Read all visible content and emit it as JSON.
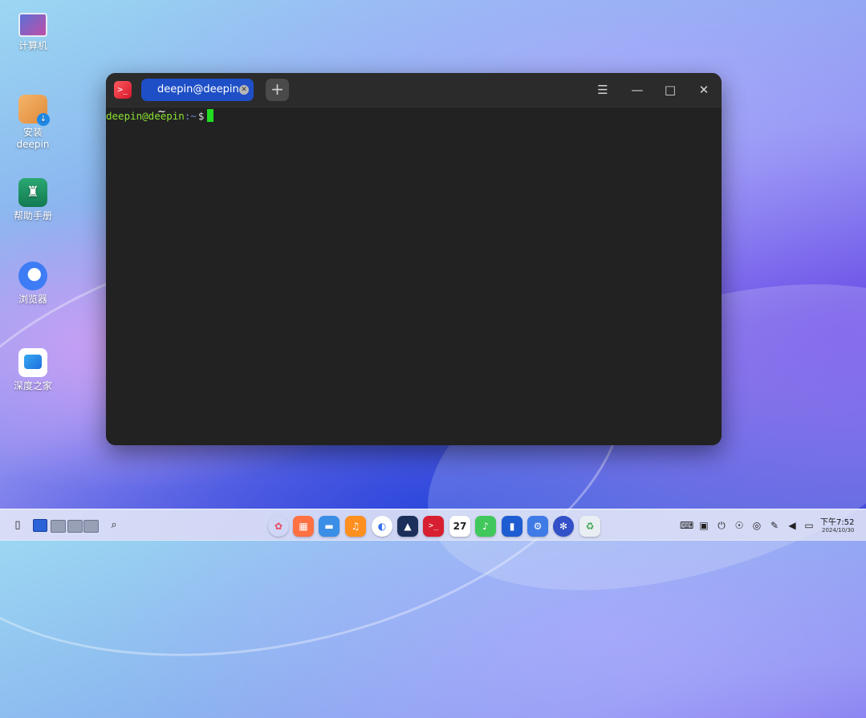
{
  "desktop": {
    "icons": [
      {
        "label": "计算机",
        "icon": "computer-icon"
      },
      {
        "label": "安装\ndeepin",
        "line1": "安装",
        "line2": "deepin",
        "icon": "install-deepin-icon"
      },
      {
        "label": "帮助手册",
        "icon": "help-manual-icon"
      },
      {
        "label": "浏览器",
        "icon": "browser-icon"
      },
      {
        "label": "深度之家",
        "icon": "deepin-home-icon"
      }
    ]
  },
  "terminal": {
    "tab_title": "deepin@deepin: ~",
    "new_tab_symbol": "+",
    "window_controls": {
      "menu": "☰",
      "minimize": "—",
      "maximize": "□",
      "close": "✕"
    },
    "prompt_user": "deepin@deepin",
    "prompt_path": ":~",
    "prompt_symbol": "$",
    "colors": {
      "background": "#222222",
      "tab_active": "#1f4fc7",
      "prompt_user": "#8ae234",
      "cursor": "#22dd22"
    }
  },
  "dock": {
    "left": {
      "trash_icon": "clipboard-icon",
      "search_icon": "🔍"
    },
    "apps": [
      {
        "name": "launcher",
        "glyph": "✿",
        "color": "#ffffff"
      },
      {
        "name": "app-store",
        "glyph": "▦",
        "color": "#ff7043"
      },
      {
        "name": "file-manager",
        "glyph": "▬",
        "color": "#3a8ee6"
      },
      {
        "name": "music-box",
        "glyph": "♫",
        "color": "#ff8f1f"
      },
      {
        "name": "browser",
        "glyph": "◐",
        "color": "#2f6cf0"
      },
      {
        "name": "photo",
        "glyph": "▲",
        "color": "#1b2f5a"
      },
      {
        "name": "terminal",
        "glyph": ">_",
        "color": "#d81f31"
      },
      {
        "name": "calendar",
        "glyph": "27",
        "color": "#ffffff"
      },
      {
        "name": "music",
        "glyph": "♪",
        "color": "#41c85c"
      },
      {
        "name": "notes",
        "glyph": "▮",
        "color": "#1e5cd1"
      },
      {
        "name": "control-center",
        "glyph": "⚙",
        "color": "#3f7be6"
      },
      {
        "name": "settings",
        "glyph": "✻",
        "color": "#3350c8"
      },
      {
        "name": "recycle",
        "glyph": "♻",
        "color": "#e9eef3"
      }
    ],
    "clock": {
      "time": "下午7:52",
      "date": "2024/10/30"
    }
  }
}
